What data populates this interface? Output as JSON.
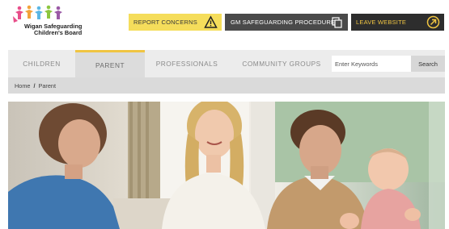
{
  "header": {
    "logo_line1": "Wigan Safeguarding",
    "logo_line2": "Children's Board",
    "report_label": "REPORT CONCERNS",
    "gm_label": "GM SAFEGUARDING PROCEDURES",
    "leave_label": "LEAVE WEBSITE"
  },
  "nav": {
    "items": [
      {
        "label": "CHILDREN"
      },
      {
        "label": "PARENT"
      },
      {
        "label": "PROFESSIONALS"
      },
      {
        "label": "COMMUNITY GROUPS"
      }
    ],
    "active_index": 1,
    "search_placeholder": "Enter Keywords",
    "search_button": "Search"
  },
  "breadcrumb": {
    "home": "Home",
    "separator": "/",
    "current": "Parent"
  },
  "colors": {
    "accent_yellow": "#f5dd5b",
    "dark_button": "#2d2d2d",
    "gm_button": "#4a4a4a",
    "nav_bg": "#ececec"
  }
}
